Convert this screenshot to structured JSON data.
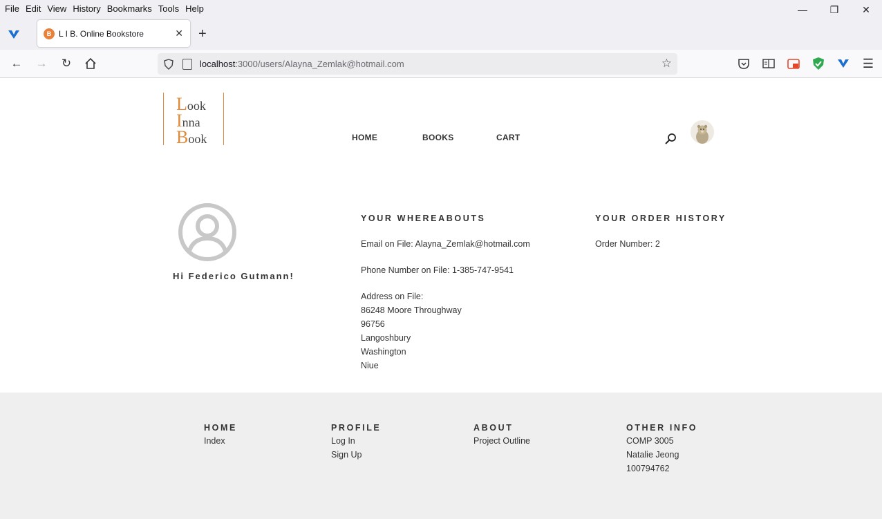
{
  "browser": {
    "menu": [
      "File",
      "Edit",
      "View",
      "History",
      "Bookmarks",
      "Tools",
      "Help"
    ],
    "tab_title": "L I B. Online Bookstore",
    "url_host": "localhost",
    "url_path": ":3000/users/Alayna_Zemlak@hotmail.com"
  },
  "site": {
    "logo": [
      {
        "cap": "L",
        "rest": "ook"
      },
      {
        "cap": "I",
        "rest": "nna"
      },
      {
        "cap": "B",
        "rest": "ook"
      }
    ],
    "nav": {
      "home": "HOME",
      "books": "BOOKS",
      "cart": "CART"
    }
  },
  "profile": {
    "greeting": "Hi Federico Gutmann!",
    "whereabouts_title": "YOUR WHEREABOUTS",
    "email_line": "Email on File: Alayna_Zemlak@hotmail.com",
    "phone_line": "Phone Number on File: 1-385-747-9541",
    "address_label": "Address on File:",
    "address": [
      "86248 Moore Throughway",
      "96756",
      "Langoshbury",
      "Washington",
      "Niue"
    ],
    "orders_title": "YOUR ORDER HISTORY",
    "order_line": "Order Number: 2"
  },
  "footer": {
    "home": {
      "title": "HOME",
      "links": [
        "Index"
      ]
    },
    "profile": {
      "title": "PROFILE",
      "links": [
        "Log In",
        "Sign Up"
      ]
    },
    "about": {
      "title": "ABOUT",
      "links": [
        "Project Outline"
      ]
    },
    "other": {
      "title": "OTHER INFO",
      "lines": [
        "COMP 3005",
        "Natalie Jeong",
        "100794762"
      ]
    }
  },
  "colors": {
    "accent": "#e08a3a",
    "footer_bg": "#efefef"
  }
}
